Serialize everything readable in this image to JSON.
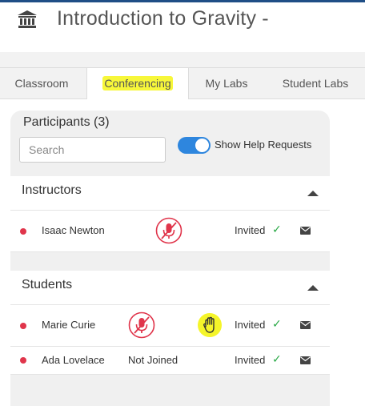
{
  "header": {
    "title": "Introduction to Gravity -",
    "icon": "institution-icon"
  },
  "tabs": [
    {
      "label": "Classroom",
      "active": false
    },
    {
      "label": "Conferencing",
      "active": true
    },
    {
      "label": "My Labs",
      "active": false
    },
    {
      "label": "Student Labs",
      "active": false
    }
  ],
  "participants": {
    "title": "Participants (3)",
    "search_placeholder": "Search",
    "toggle_label": "Show Help Requests",
    "toggle_on": true
  },
  "instructors": {
    "title": "Instructors",
    "rows": [
      {
        "name": "Isaac Newton",
        "status": "Invited",
        "muted": true
      }
    ]
  },
  "students": {
    "title": "Students",
    "rows": [
      {
        "name": "Marie Curie",
        "status": "Invited",
        "muted": true,
        "hand_raised": true
      },
      {
        "name": "Ada Lovelace",
        "status": "Invited",
        "joined_text": "Not Joined"
      }
    ]
  },
  "colors": {
    "accent": "#2e86de",
    "highlight": "#f7f73a",
    "status_dot": "#e0354b",
    "check": "#27a844",
    "muted_mic": "#e0354b"
  }
}
